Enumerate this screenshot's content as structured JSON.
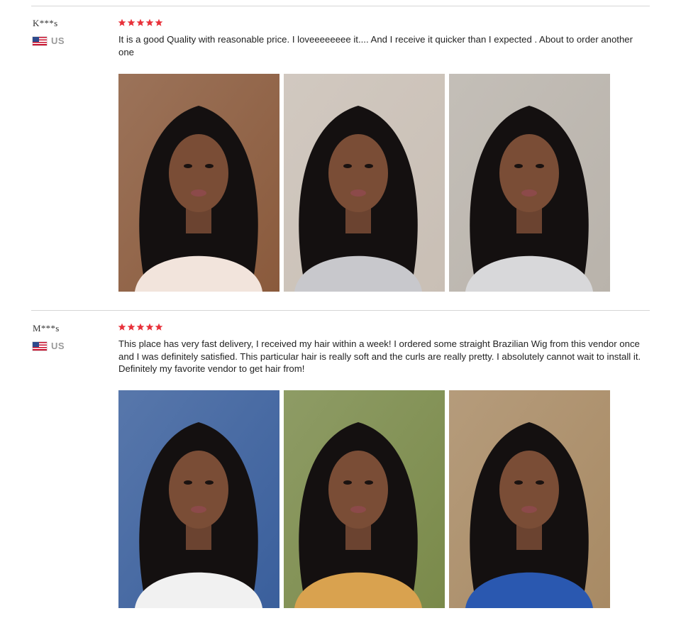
{
  "reviews": [
    {
      "reviewer": "K***s",
      "country": "US",
      "rating": 5,
      "text": "It is a good Quality with reasonable price. I loveeeeeeee it.... And I receive it quicker than I expected . About to order another one",
      "photos": [
        {
          "name": "review-photo",
          "bg": "#8a5a3c",
          "accent": "#f2e4dc"
        },
        {
          "name": "review-photo",
          "bg": "#c9bfb5",
          "accent": "#c8c8cc"
        },
        {
          "name": "review-photo",
          "bg": "#b9b3ab",
          "accent": "#d8d8da"
        }
      ]
    },
    {
      "reviewer": "M***s",
      "country": "US",
      "rating": 5,
      "text": "This place has very fast delivery, I received my hair within a week! I ordered some straight Brazilian Wig from this vendor once and I was definitely satisfied. This particular hair is really soft and the curls are really pretty. I absolutely cannot wait to install it. Definitely my favorite vendor to get hair from!",
      "photos": [
        {
          "name": "review-photo",
          "bg": "#3a5f9c",
          "accent": "#f1f1f1"
        },
        {
          "name": "review-photo",
          "bg": "#7a8a4a",
          "accent": "#d9a24f"
        },
        {
          "name": "review-photo",
          "bg": "#a88a64",
          "accent": "#2a58b0"
        }
      ]
    }
  ],
  "colors": {
    "star": "#e8313a",
    "divider": "#d6d6d6"
  }
}
